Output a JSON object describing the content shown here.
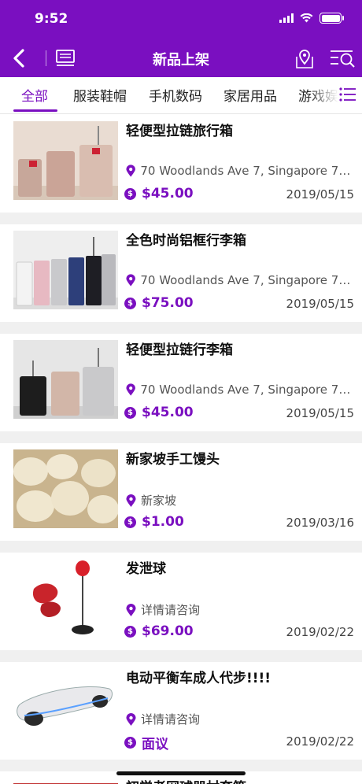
{
  "status_bar": {
    "time": "9:52"
  },
  "nav": {
    "title": "新品上架"
  },
  "colors": {
    "accent": "#7a0fc0"
  },
  "tabs": [
    {
      "label": "全部",
      "active": true
    },
    {
      "label": "服装鞋帽",
      "active": false
    },
    {
      "label": "手机数码",
      "active": false
    },
    {
      "label": "家居用品",
      "active": false
    },
    {
      "label": "游戏娱",
      "active": false
    }
  ],
  "items": [
    {
      "title": "轻便型拉链旅行箱",
      "location": "70 Woodlands Ave 7, Singapore 738...",
      "price": "$45.00",
      "date": "2019/05/15",
      "image": "luggage-set-image"
    },
    {
      "title": "全色时尚铝框行李箱",
      "location": "70 Woodlands Ave 7, Singapore 738...",
      "price": "$75.00",
      "date": "2019/05/15",
      "image": "colorful-luggage-image"
    },
    {
      "title": "轻便型拉链行李箱",
      "location": "70 Woodlands Ave 7, Singapore 738...",
      "price": "$45.00",
      "date": "2019/05/15",
      "image": "luggage-trio-image"
    },
    {
      "title": "新家坡手工馒头",
      "location": "新家坡",
      "price": "$1.00",
      "date": "2019/03/16",
      "image": "steamed-buns-image"
    },
    {
      "title": "发泄球",
      "location": "详情请咨询",
      "price": "$69.00",
      "date": "2019/02/22",
      "image": "punching-ball-image"
    },
    {
      "title": "电动平衡车成人代步!!!!",
      "location": "详情请咨询",
      "price": "面议",
      "date": "2019/02/22",
      "image": "hoverboard-image"
    },
    {
      "title": "初学者网球器材套箱",
      "location": "",
      "price": "",
      "date": "",
      "image": "tennis-image"
    }
  ]
}
